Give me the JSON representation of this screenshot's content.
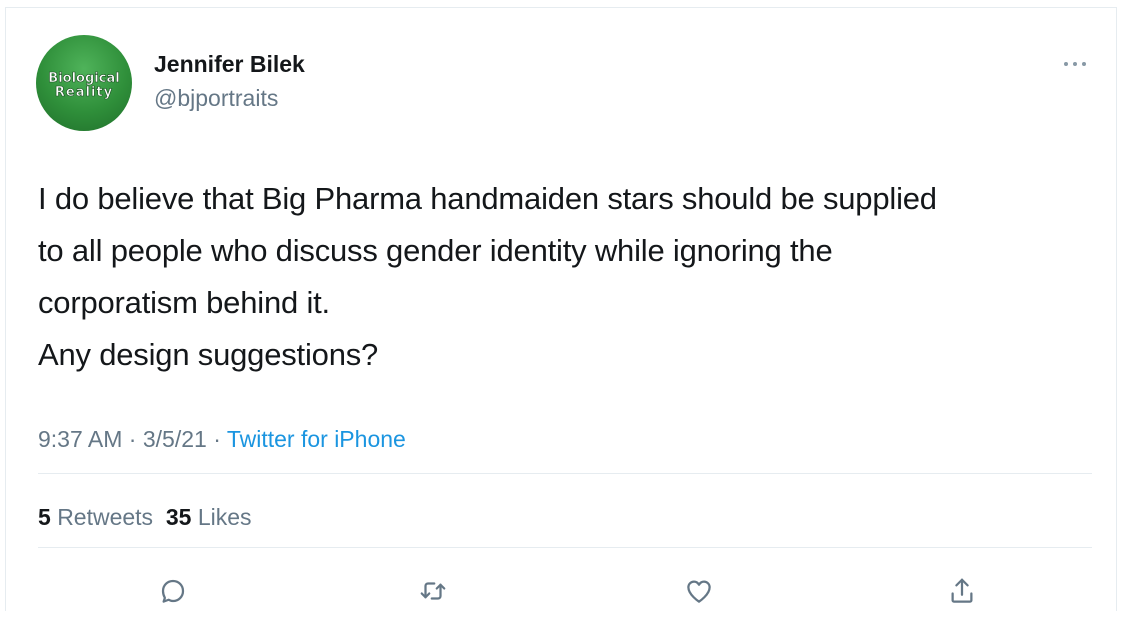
{
  "author": {
    "name": "Jennifer Bilek",
    "handle": "@bjportraits",
    "avatar_text_line1": "Biological",
    "avatar_text_line2": "Reality"
  },
  "tweet": {
    "lines": [
      "I do believe that Big Pharma handmaiden stars should be supplied",
      "to all people who discuss gender identity while ignoring the",
      "corporatism behind it.",
      "Any design suggestions?"
    ],
    "time": "9:37 AM",
    "date": "3/5/21",
    "separator": "·",
    "source": "Twitter for iPhone"
  },
  "stats": {
    "retweets_count": "5",
    "retweets_label": "Retweets",
    "likes_count": "35",
    "likes_label": "Likes"
  },
  "actions": {
    "icons": [
      "reply-icon",
      "retweet-icon",
      "like-icon",
      "share-icon"
    ]
  },
  "colors": {
    "text_primary": "#14171a",
    "text_secondary": "#657786",
    "link": "#1b95e0",
    "divider": "#e6ecf0",
    "avatar_green": "#2f8f3a"
  }
}
